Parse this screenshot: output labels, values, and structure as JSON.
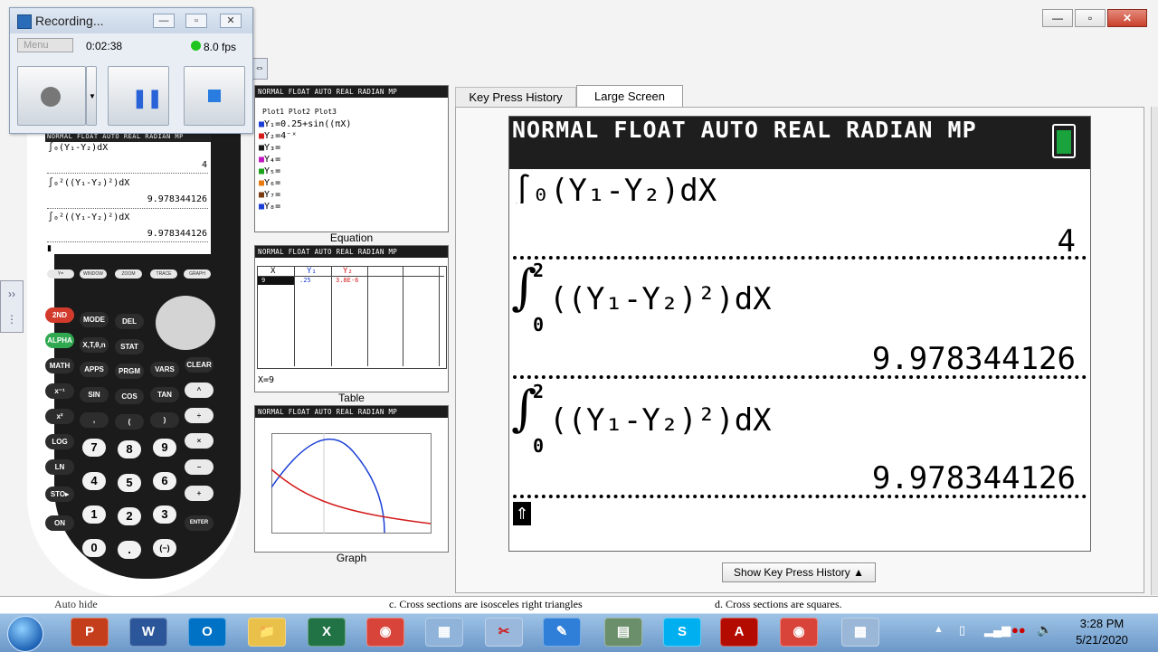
{
  "recorder": {
    "title": "Recording...",
    "menu_label": "Menu",
    "elapsed": "0:02:38",
    "fps": "8.0 fps",
    "status_color": "#1fc51f"
  },
  "calculator": {
    "header": "NORMAL FLOAT AUTO REAL RADIAN MP",
    "line_partial": "∫₀(Y₁-Y₂)dX",
    "result_partial": "4",
    "expr1": "∫₀²((Y₁-Y₂)²)dX",
    "result1": "9.978344126",
    "expr2": "∫₀²((Y₁-Y₂)²)dX",
    "result2": "9.978344126",
    "fkeys": [
      "Y=",
      "WINDOW",
      "ZOOM",
      "TRACE",
      "GRAPH"
    ],
    "keys_row1": [
      "2ND",
      "MODE",
      "DEL"
    ],
    "keys_row2": [
      "ALPHA",
      "X,T,θ,n",
      "STAT"
    ],
    "keys_row3": [
      "MATH",
      "APPS",
      "PRGM",
      "VARS",
      "CLEAR"
    ],
    "keys_row4": [
      "x⁻¹",
      "SIN",
      "COS",
      "TAN",
      "^"
    ],
    "keys_row5": [
      "x²",
      ",",
      "(",
      ")",
      "÷"
    ],
    "keys_row6": [
      "LOG",
      "7",
      "8",
      "9",
      "×"
    ],
    "keys_row7": [
      "LN",
      "4",
      "5",
      "6",
      "−"
    ],
    "keys_row8": [
      "STO▸",
      "1",
      "2",
      "3",
      "+"
    ],
    "keys_row9": [
      "ON",
      "0",
      ".",
      "(−)",
      "ENTER"
    ]
  },
  "equation_panel": {
    "header": "NORMAL FLOAT AUTO REAL RADIAN MP",
    "plots": "Plot1  Plot2  Plot3",
    "y1": "Y₁=0.25+sin((πX)",
    "y2": "Y₂=4⁻ˣ",
    "y3": "Y₃=",
    "y4": "Y₄=",
    "y5": "Y₅=",
    "y6": "Y₆=",
    "y7": "Y₇=",
    "y8": "Y₈=",
    "label": "Equation"
  },
  "table_panel": {
    "header": "NORMAL FLOAT AUTO REAL RADIAN MP",
    "col_x": "X",
    "col_y1": "Y₁",
    "col_y2": "Y₂",
    "row_x": "9",
    "row_y1": ".25",
    "row_y2": "3.8E-6",
    "footer": "X=9",
    "label": "Table"
  },
  "graph_panel": {
    "header": "NORMAL FLOAT AUTO REAL RADIAN MP",
    "label": "Graph"
  },
  "tabs": {
    "history": "Key Press History",
    "large": "Large Screen"
  },
  "large_screen": {
    "header": "NORMAL FLOAT AUTO REAL RADIAN MP",
    "partial_line": "∫₀(Y₁-Y₂)dX",
    "partial_result": "4",
    "upper": "2",
    "lower": "0",
    "expr": "((Y₁-Y₂)²)dX",
    "result1": "9.978344126",
    "result2": "9.978344126"
  },
  "show_history_button": "Show Key Press History ▲",
  "doc_strip": {
    "left": "Auto hide",
    "c": "c.  Cross sections are isosceles right triangles",
    "d": "d.  Cross sections are squares."
  },
  "taskbar": {
    "icons": [
      "P",
      "W",
      "O",
      "📁",
      "X",
      "◉",
      "▦",
      "✂",
      "✎",
      "▤",
      "S",
      "A",
      "◉",
      "▩"
    ],
    "time": "3:28 PM",
    "date": "5/21/2020"
  }
}
